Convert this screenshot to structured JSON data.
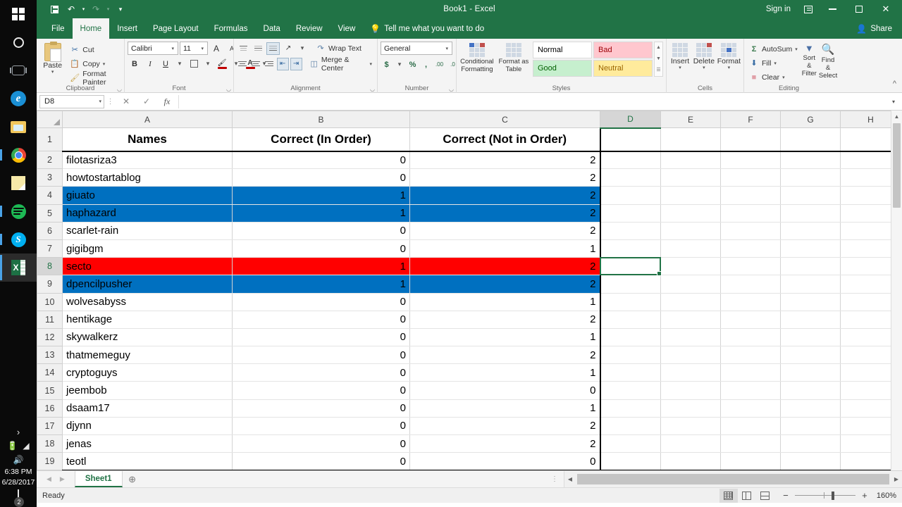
{
  "taskbar": {
    "icons": [
      {
        "name": "windows-start-icon",
        "label": "Start"
      },
      {
        "name": "cortana-search-icon",
        "label": "Cortana"
      },
      {
        "name": "task-view-icon",
        "label": "Task View"
      },
      {
        "name": "edge-icon",
        "label": "Microsoft Edge",
        "glyph": "e"
      },
      {
        "name": "file-explorer-icon",
        "label": "File Explorer"
      },
      {
        "name": "chrome-icon",
        "label": "Google Chrome"
      },
      {
        "name": "sticky-notes-icon",
        "label": "Sticky Notes"
      },
      {
        "name": "spotify-icon",
        "label": "Spotify"
      },
      {
        "name": "skype-icon",
        "label": "Skype",
        "glyph": "S",
        "badge": "!"
      },
      {
        "name": "excel-taskbar-icon",
        "label": "Excel",
        "glyph": "X"
      }
    ],
    "tray": {
      "chevron": "›",
      "battery": "🔋",
      "wifi": "◢",
      "volume": "🔊",
      "time": "6:38 PM",
      "date": "6/28/2017",
      "notification_count": "2"
    }
  },
  "titlebar": {
    "title": "Book1  -  Excel",
    "quick_access": [
      "Save",
      "Undo",
      "Redo",
      "Customize Quick Access Toolbar"
    ],
    "sign_in": "Sign in",
    "ribbon_display_options": "Ribbon Display Options",
    "minimize": "Minimize",
    "restore": "Restore Down",
    "close": "Close"
  },
  "ribbon": {
    "tabs": [
      {
        "label": "File",
        "selected": false
      },
      {
        "label": "Home",
        "selected": true
      },
      {
        "label": "Insert",
        "selected": false
      },
      {
        "label": "Page Layout",
        "selected": false
      },
      {
        "label": "Formulas",
        "selected": false
      },
      {
        "label": "Data",
        "selected": false
      },
      {
        "label": "Review",
        "selected": false
      },
      {
        "label": "View",
        "selected": false
      }
    ],
    "tell_me": "Tell me what you want to do",
    "share": "Share",
    "groups": {
      "clipboard": {
        "label": "Clipboard",
        "paste": "Paste",
        "cut": "Cut",
        "copy": "Copy",
        "format_painter": "Format Painter"
      },
      "font": {
        "label": "Font",
        "font_name": "Calibri",
        "font_size": "11",
        "grow_font": "A",
        "shrink_font": "A",
        "bold": "B",
        "italic": "I",
        "underline": "U",
        "borders": "Borders",
        "fill_color": "A",
        "font_color": "A"
      },
      "alignment": {
        "label": "Alignment",
        "wrap_text": "Wrap Text",
        "merge_center": "Merge & Center"
      },
      "number": {
        "label": "Number",
        "format": "General",
        "accounting": "$",
        "percent": "%",
        "comma": ",",
        "increase_decimal": ".00",
        "decrease_decimal": ".0"
      },
      "styles": {
        "label": "Styles",
        "conditional_formatting": "Conditional Formatting",
        "format_as_table": "Format as Table",
        "cells": [
          {
            "label": "Normal",
            "bg": "#ffffff",
            "fg": "#000000"
          },
          {
            "label": "Bad",
            "bg": "#ffc7ce",
            "fg": "#9c0006"
          },
          {
            "label": "Good",
            "bg": "#c6efce",
            "fg": "#006100"
          },
          {
            "label": "Neutral",
            "bg": "#ffeb9c",
            "fg": "#9c6500"
          }
        ]
      },
      "cells": {
        "label": "Cells",
        "insert": "Insert",
        "delete": "Delete",
        "format": "Format"
      },
      "editing": {
        "label": "Editing",
        "autosum": "AutoSum",
        "fill": "Fill",
        "clear": "Clear",
        "sort_filter": "Sort & Filter",
        "find_select": "Find & Select"
      }
    }
  },
  "formula_bar": {
    "name_box": "D8",
    "cancel": "✕",
    "enter": "✓",
    "insert_function": "fx",
    "formula_value": ""
  },
  "sheet": {
    "columns": [
      "A",
      "B",
      "C",
      "D",
      "E",
      "F",
      "G",
      "H"
    ],
    "selected_column": "D",
    "selected_row": "8",
    "selected_cell": "D8",
    "headers": {
      "A": "Names",
      "B": "Correct (In Order)",
      "C": "Correct (Not in Order)"
    },
    "rows": [
      {
        "n": "2",
        "name": "filotasriza3",
        "in_order": "0",
        "not_in_order": "2",
        "fill": "none"
      },
      {
        "n": "3",
        "name": "howtostartablog",
        "in_order": "0",
        "not_in_order": "2",
        "fill": "none"
      },
      {
        "n": "4",
        "name": "giuato",
        "in_order": "1",
        "not_in_order": "2",
        "fill": "blue"
      },
      {
        "n": "5",
        "name": "haphazard",
        "in_order": "1",
        "not_in_order": "2",
        "fill": "blue"
      },
      {
        "n": "6",
        "name": "scarlet-rain",
        "in_order": "0",
        "not_in_order": "2",
        "fill": "none"
      },
      {
        "n": "7",
        "name": "gigibgm",
        "in_order": "0",
        "not_in_order": "1",
        "fill": "none"
      },
      {
        "n": "8",
        "name": "secto",
        "in_order": "1",
        "not_in_order": "2",
        "fill": "red"
      },
      {
        "n": "9",
        "name": "dpencilpusher",
        "in_order": "1",
        "not_in_order": "2",
        "fill": "blue"
      },
      {
        "n": "10",
        "name": "wolvesabyss",
        "in_order": "0",
        "not_in_order": "1",
        "fill": "none"
      },
      {
        "n": "11",
        "name": "hentikage",
        "in_order": "0",
        "not_in_order": "2",
        "fill": "none"
      },
      {
        "n": "12",
        "name": "skywalkerz",
        "in_order": "0",
        "not_in_order": "1",
        "fill": "none"
      },
      {
        "n": "13",
        "name": "thatmemeguy",
        "in_order": "0",
        "not_in_order": "2",
        "fill": "none"
      },
      {
        "n": "14",
        "name": "cryptoguys",
        "in_order": "0",
        "not_in_order": "1",
        "fill": "none"
      },
      {
        "n": "15",
        "name": "jeembob",
        "in_order": "0",
        "not_in_order": "0",
        "fill": "none"
      },
      {
        "n": "16",
        "name": "dsaam17",
        "in_order": "0",
        "not_in_order": "1",
        "fill": "none"
      },
      {
        "n": "17",
        "name": "djynn",
        "in_order": "0",
        "not_in_order": "2",
        "fill": "none"
      },
      {
        "n": "18",
        "name": "jenas",
        "in_order": "0",
        "not_in_order": "2",
        "fill": "none"
      },
      {
        "n": "19",
        "name": "teotl",
        "in_order": "0",
        "not_in_order": "0",
        "fill": "none"
      }
    ],
    "fill_colors": {
      "blue": "#0070c0",
      "red": "#ff0000",
      "none": "#ffffff"
    }
  },
  "sheet_tabs": {
    "tabs": [
      {
        "label": "Sheet1",
        "selected": true
      }
    ],
    "add_sheet": "+",
    "prev": "◀",
    "next": "▶"
  },
  "status_bar": {
    "status": "Ready",
    "views": [
      "Normal",
      "Page Layout",
      "Page Break Preview"
    ],
    "zoom_out": "−",
    "zoom_in": "+",
    "zoom": "160%"
  },
  "colors": {
    "excel_green": "#217346",
    "accent_blue": "#0070c0",
    "accent_red": "#ff0000"
  }
}
